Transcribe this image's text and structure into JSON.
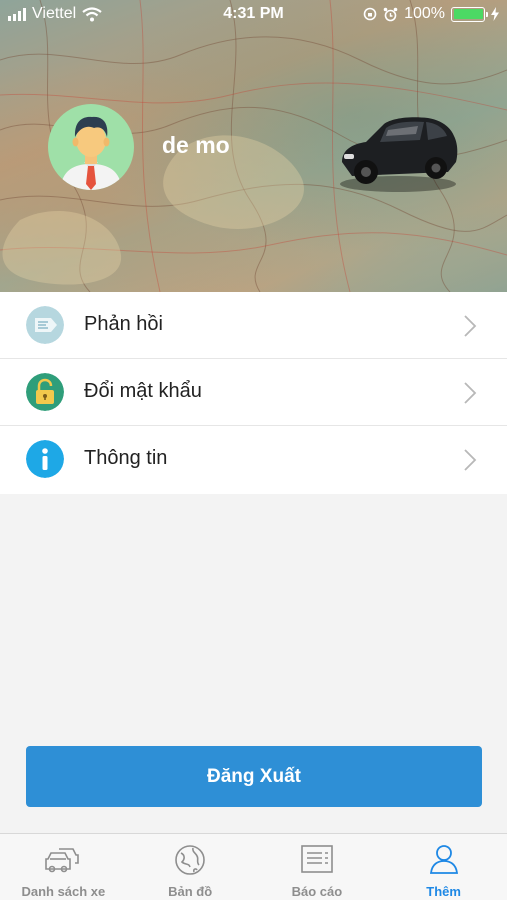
{
  "status_bar": {
    "carrier": "Viettel",
    "time": "4:31 PM",
    "battery": "100%"
  },
  "profile": {
    "username": "de mo"
  },
  "menu": {
    "items": [
      {
        "label": "Phản hồi",
        "icon": "feedback-icon"
      },
      {
        "label": "Đổi mật khẩu",
        "icon": "lock-icon"
      },
      {
        "label": "Thông tin",
        "icon": "info-icon"
      }
    ]
  },
  "logout_label": "Đăng Xuất",
  "tabs": [
    {
      "label": "Danh sách xe",
      "icon": "cars-icon",
      "active": false
    },
    {
      "label": "Bản đồ",
      "icon": "globe-icon",
      "active": false
    },
    {
      "label": "Báo cáo",
      "icon": "report-icon",
      "active": false
    },
    {
      "label": "Thêm",
      "icon": "person-icon",
      "active": true
    }
  ],
  "colors": {
    "accent": "#2e8fd6",
    "active_tab": "#1e88e5",
    "battery": "#4cd964",
    "avatar_bg": "#9fe0a8"
  }
}
